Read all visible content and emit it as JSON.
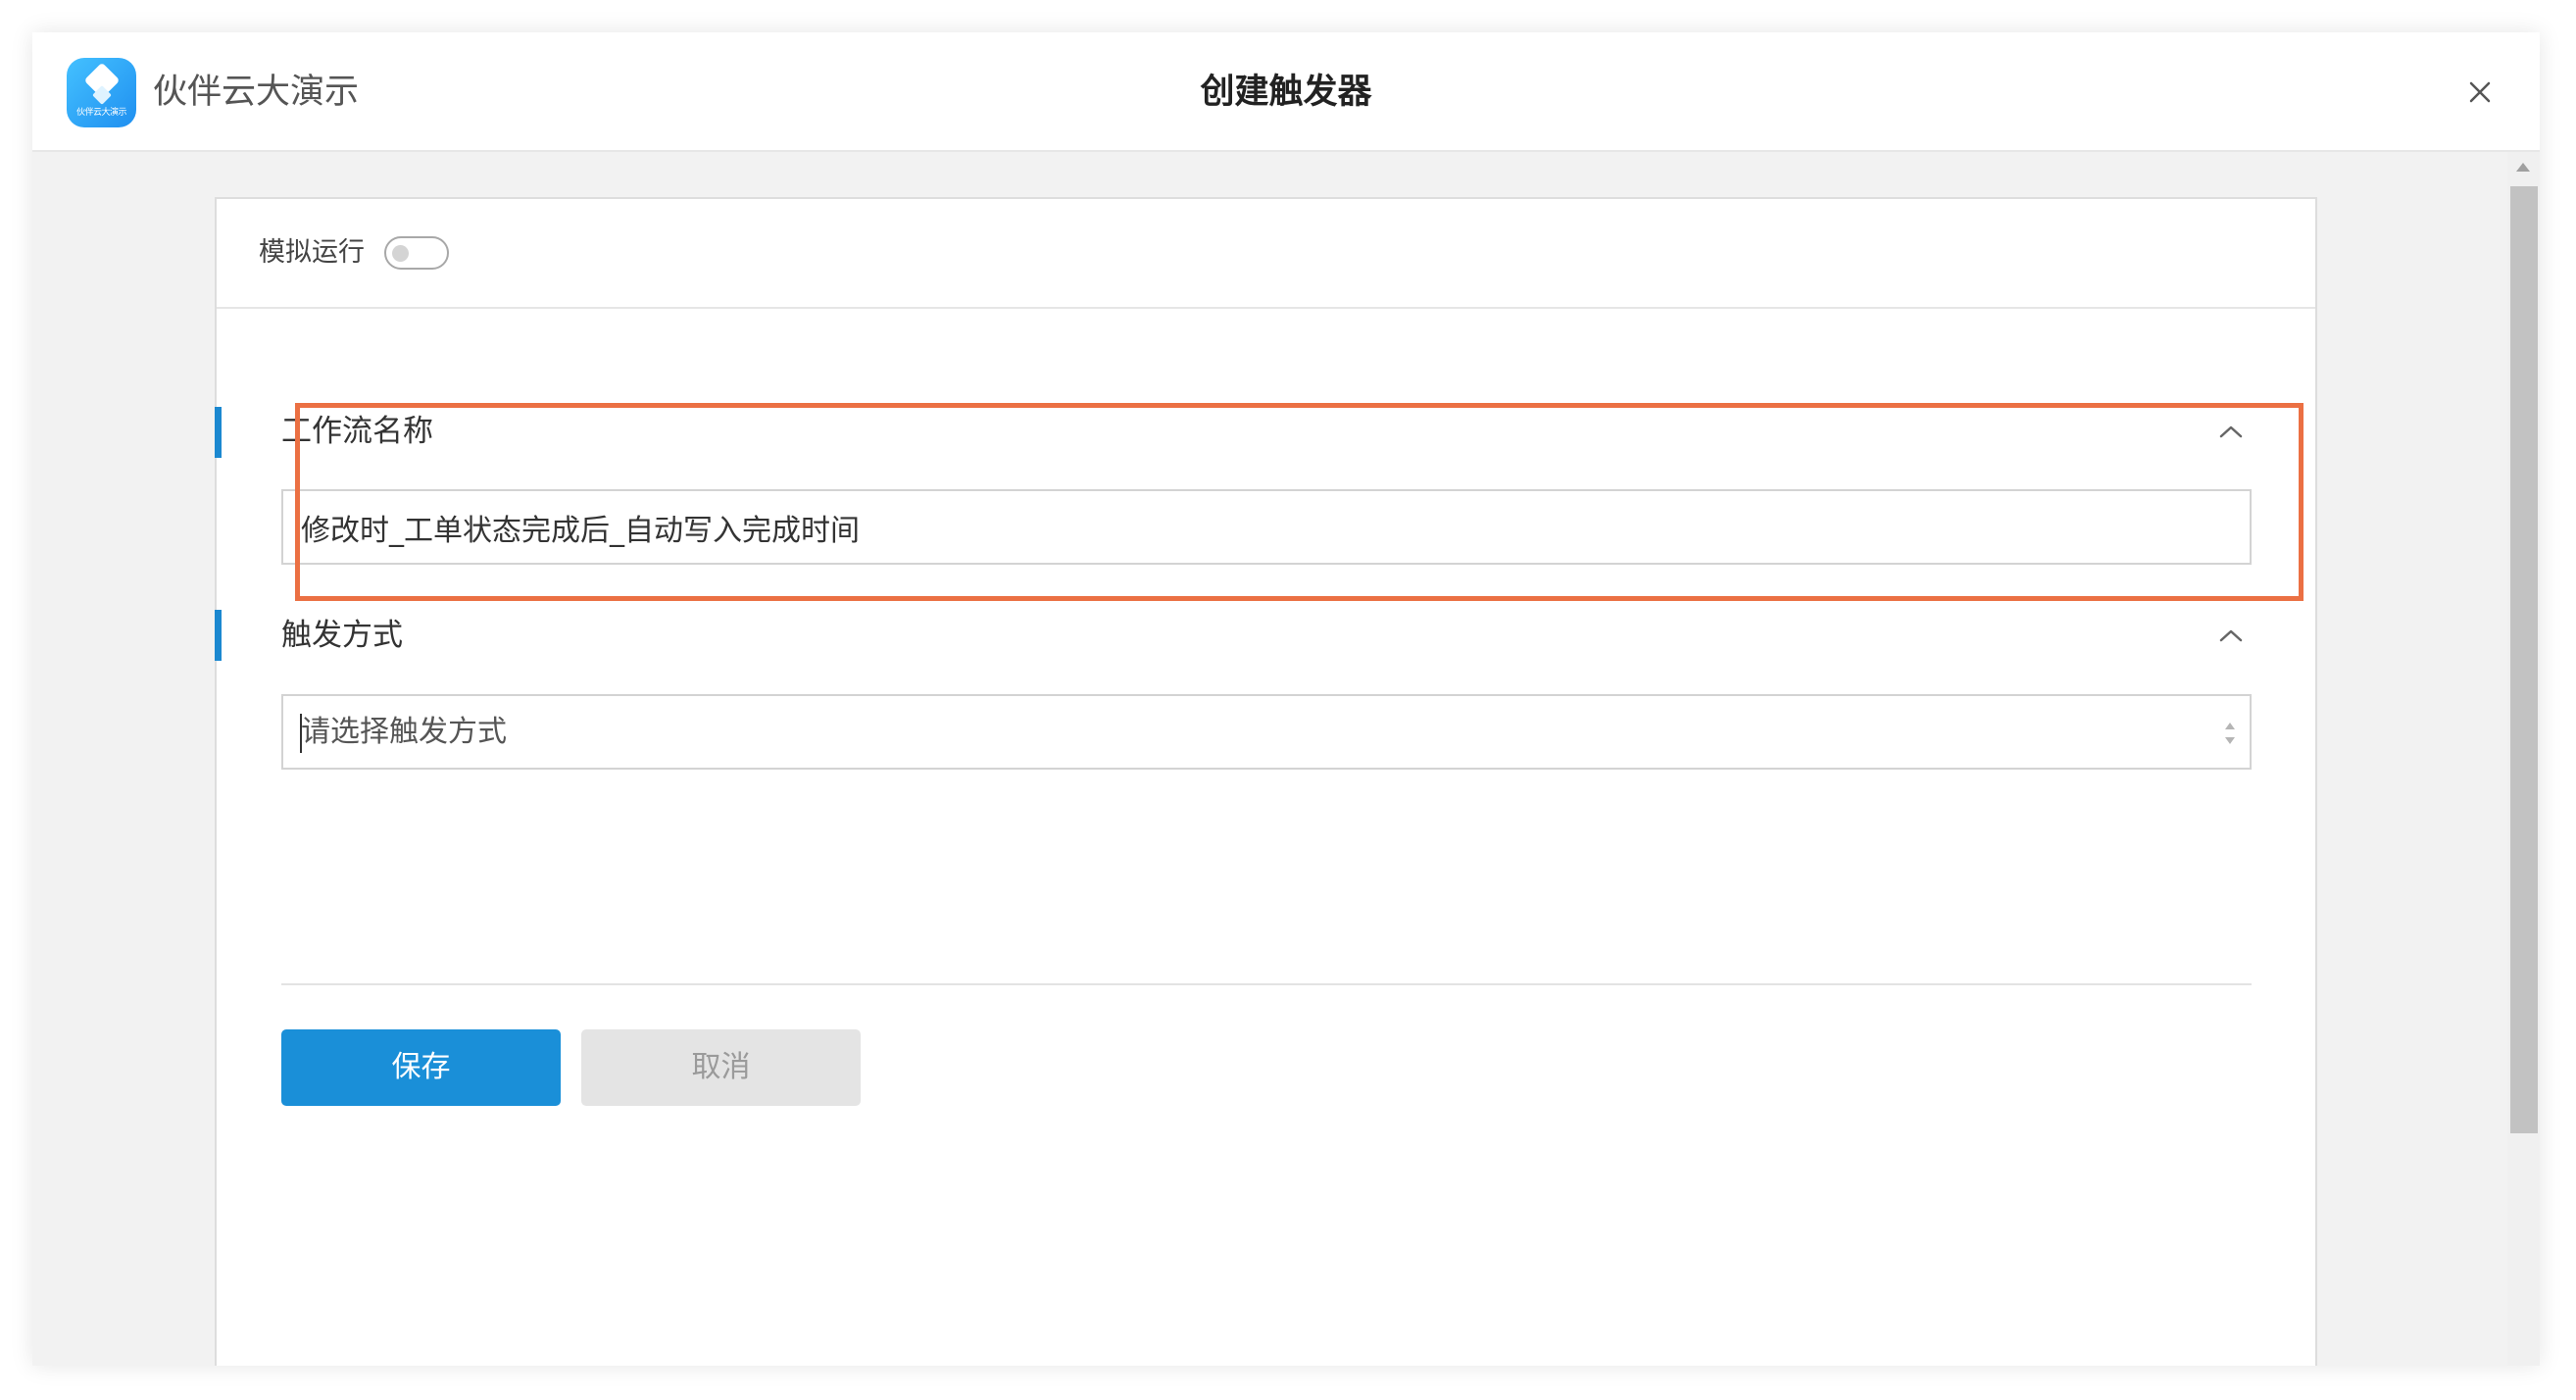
{
  "app": {
    "name": "伙伴云大演示",
    "logo_caption": "伙伴云大演示"
  },
  "dialog": {
    "title": "创建触发器"
  },
  "simulate": {
    "label": "模拟运行",
    "enabled": false
  },
  "workflow_name": {
    "section_title": "工作流名称",
    "value": "修改时_工单状态完成后_自动写入完成时间"
  },
  "trigger_method": {
    "section_title": "触发方式",
    "placeholder": "请选择触发方式"
  },
  "actions": {
    "save_label": "保存",
    "cancel_label": "取消"
  },
  "icons": {
    "close": "close-icon",
    "collapse": "chevron-up-icon",
    "spinner": "up-down-arrows-icon",
    "logo": "app-logo-icon"
  },
  "colors": {
    "accent": "#1a8fd8",
    "section_bar": "#1b88d0",
    "highlight": "#eb7043"
  }
}
